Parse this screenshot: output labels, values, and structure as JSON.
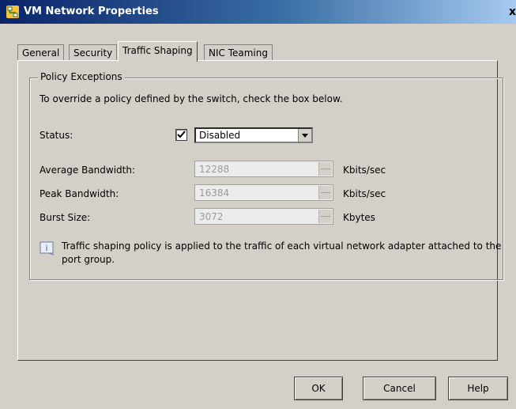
{
  "window": {
    "title": "VM Network Properties",
    "close_glyph": "x"
  },
  "tabs": [
    {
      "label": "General"
    },
    {
      "label": "Security"
    },
    {
      "label": "Traffic Shaping"
    },
    {
      "label": "NIC Teaming"
    }
  ],
  "active_tab": "Traffic Shaping",
  "policy": {
    "legend": "Policy Exceptions",
    "instruction": "To override a policy defined by the switch, check the box below.",
    "status_label": "Status:",
    "status_checked": true,
    "status_value": "Disabled",
    "average_label": "Average Bandwidth:",
    "average_value": "12288",
    "average_unit": "Kbits/sec",
    "peak_label": "Peak Bandwidth:",
    "peak_value": "16384",
    "peak_unit": "Kbits/sec",
    "burst_label": "Burst Size:",
    "burst_value": "3072",
    "burst_unit": "Kbytes",
    "info_text": "Traffic shaping policy is applied to the traffic of each virtual network adapter attached to the port group."
  },
  "buttons": {
    "ok": "OK",
    "cancel": "Cancel",
    "help": "Help"
  },
  "icons": {
    "app": "network-icon",
    "info": "info-icon",
    "check": "checkmark-icon",
    "dropdown": "chevron-down-icon"
  }
}
